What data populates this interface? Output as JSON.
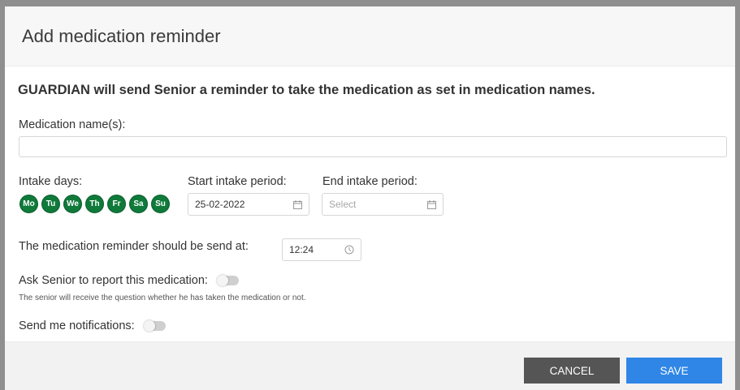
{
  "dialog": {
    "title": "Add medication reminder",
    "intro": "GUARDIAN will send Senior a reminder to take the medication as set in medication names."
  },
  "medication_name": {
    "label": "Medication name(s):",
    "value": ""
  },
  "intake_days": {
    "label": "Intake days:",
    "days": [
      "Mo",
      "Tu",
      "We",
      "Th",
      "Fr",
      "Sa",
      "Su"
    ],
    "selected_color": "#0f7a3a"
  },
  "start_period": {
    "label": "Start intake period:",
    "value": "25-02-2022",
    "icon": "calendar-icon"
  },
  "end_period": {
    "label": "End intake period:",
    "placeholder": "Select",
    "icon": "calendar-icon"
  },
  "reminder_time": {
    "label": "The medication reminder should be send at:",
    "value": "12:24",
    "icon": "clock-icon"
  },
  "report": {
    "label": "Ask Senior to report this medication:",
    "enabled": false,
    "hint": "The senior will receive the question whether he has taken the medication or not."
  },
  "notifications": {
    "label": "Send me notifications:",
    "enabled": false
  },
  "footer": {
    "cancel_label": "CANCEL",
    "save_label": "SAVE",
    "save_color": "#2f86e6"
  }
}
